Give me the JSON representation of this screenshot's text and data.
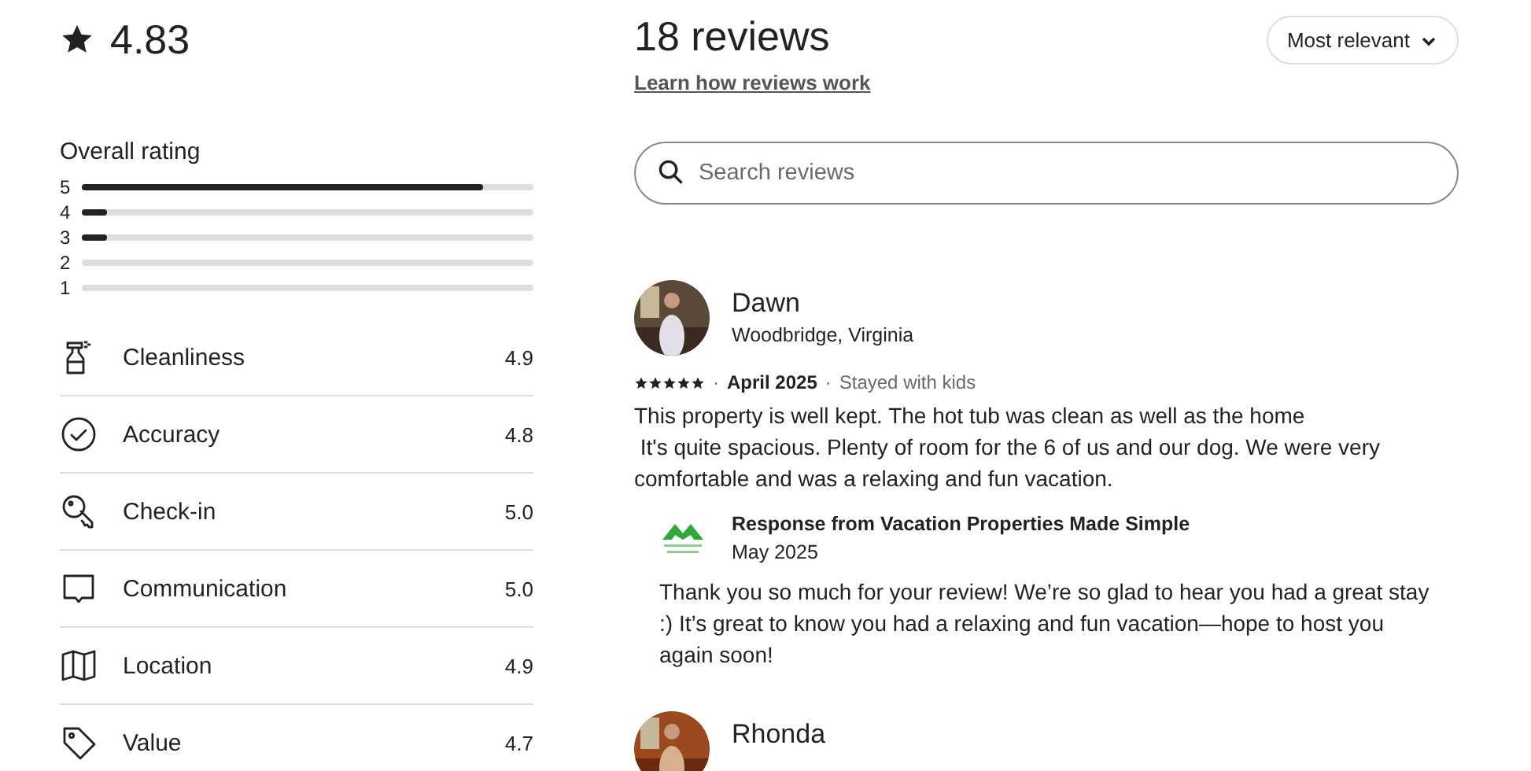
{
  "overall": {
    "score": "4.83"
  },
  "rating_breakdown": {
    "title": "Overall rating",
    "bars": [
      {
        "label": "5",
        "level": 0.89
      },
      {
        "label": "4",
        "level": 0.055
      },
      {
        "label": "3",
        "level": 0.055
      },
      {
        "label": "2"
      },
      {
        "label": "1"
      }
    ]
  },
  "categories": [
    {
      "kind": "spray",
      "label": "Cleanliness",
      "score": "4.9"
    },
    {
      "kind": "check",
      "label": "Accuracy",
      "score": "4.8"
    },
    {
      "kind": "key",
      "label": "Check-in",
      "score": "5.0"
    },
    {
      "kind": "chat",
      "label": "Communication",
      "score": "5.0"
    },
    {
      "kind": "map",
      "label": "Location",
      "score": "4.9"
    },
    {
      "kind": "tag",
      "label": "Value",
      "score": "4.7"
    }
  ],
  "header": {
    "title": "18 reviews",
    "link": "Learn how reviews work",
    "sort": "Most relevant"
  },
  "search": {
    "placeholder": "Search reviews"
  },
  "reviews": [
    {
      "name": "Dawn",
      "location": "Woodbridge, Virginia",
      "stars": 5,
      "separators": [
        "·",
        "·"
      ],
      "date": "April 2025",
      "trip": "Stayed with kids",
      "text": "This property is well kept. The hot tub was clean as well as the home\n It's quite spacious. Plenty of room for the 6 of us and our dog. We were very comfortable and was a relaxing and fun vacation.",
      "response": {
        "title": "Response from Vacation Properties Made Simple",
        "date": "May 2025",
        "text": "Thank you so much for your review! We’re so glad to hear you had a great stay :) It’s great to know you had a relaxing and fun vacation—hope to host you again soon!"
      }
    },
    {
      "name": "Rhonda"
    }
  ]
}
